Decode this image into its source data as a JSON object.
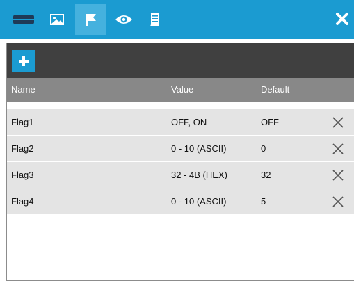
{
  "toolbar_tabs": [
    {
      "icon": "device-icon"
    },
    {
      "icon": "image-icon"
    },
    {
      "icon": "flag-icon",
      "active": true
    },
    {
      "icon": "eye-icon"
    },
    {
      "icon": "script-icon"
    }
  ],
  "close_icon": "close-icon",
  "colors": {
    "accent": "#1b9bd1",
    "active_tab": "#45b1de",
    "toolbar": "#404040",
    "header": "#888888",
    "row": "#e4e4e4"
  },
  "table": {
    "columns": [
      "Name",
      "Value",
      "Default"
    ],
    "rows": [
      {
        "name": "Flag1",
        "value": "OFF, ON",
        "default": "OFF"
      },
      {
        "name": "Flag2",
        "value": "0 - 10 (ASCII)",
        "default": "0"
      },
      {
        "name": "Flag3",
        "value": "32 - 4B (HEX)",
        "default": "32"
      },
      {
        "name": "Flag4",
        "value": "0 - 10 (ASCII)",
        "default": "5"
      }
    ]
  }
}
